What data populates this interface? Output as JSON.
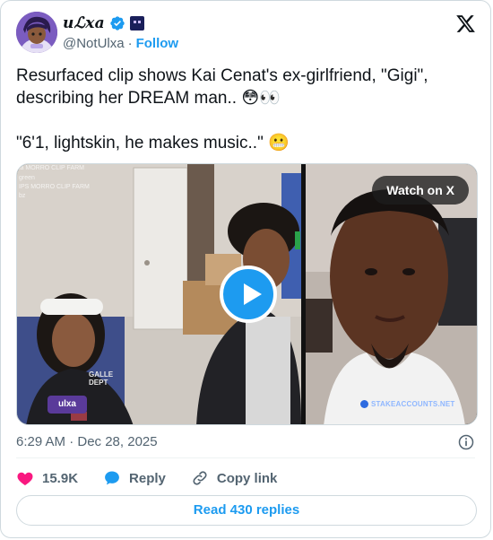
{
  "author": {
    "display_name": "uℒxa",
    "handle": "@NotUlxa",
    "follow_label": "Follow",
    "verified": true,
    "separator": "·"
  },
  "tweet": {
    "line1": "Resurfaced clip shows Kai Cenat's ex-girlfriend, \"Gigi\", describing her DREAM man.. 😳👀",
    "line2": "\"6'1, lightskin, he makes music..\" 😬"
  },
  "media": {
    "watch_label": "Watch on X",
    "watermark_top": "ia MORRO CLIP FARM",
    "watermark_green": "green",
    "watermark_mid": "IPS MORRO CLIP FARM",
    "watermark_small": "bz",
    "shirt_text": "GALLE DEPT",
    "logo_text": "ulxa",
    "stake_text": "STAKEACCOUNTS.NET"
  },
  "meta": {
    "timestamp": "6:29 AM · Dec 28, 2025"
  },
  "actions": {
    "likes": "15.9K",
    "reply_label": "Reply",
    "copy_label": "Copy link"
  },
  "replies_button": "Read 430 replies",
  "colors": {
    "accent": "#1d9bf0",
    "like": "#f91880",
    "text": "#0f1419",
    "muted": "#536471"
  },
  "icons": {
    "brand": "x-logo-icon",
    "verified": "verified-badge-icon",
    "info": "info-icon",
    "like": "heart-icon",
    "reply": "speech-bubble-icon",
    "copy": "link-icon",
    "play": "play-icon"
  }
}
